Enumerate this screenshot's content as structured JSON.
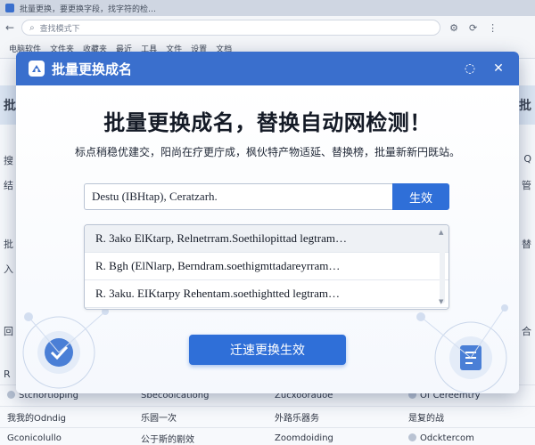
{
  "browser": {
    "tab_title": "批量更换，要更换字段，找字符的检…",
    "address": "查找模式下",
    "bookmarks": [
      "电脑软件",
      "文件夹",
      "收藏夹",
      "最近",
      "工具",
      "文件",
      "设置",
      "文档"
    ]
  },
  "background": {
    "left_labels": [
      "批",
      "搜",
      "结",
      "批",
      "入",
      "回",
      "R"
    ],
    "right_labels": [
      "批",
      "Q",
      "管",
      "替",
      "合"
    ],
    "rows": [
      [
        "Stchortloping",
        "Sbecoolcationg",
        "Zucxoorauoe",
        "Of Cereemtry"
      ],
      [
        "我我的Odndig",
        "乐圆一次",
        "外路乐器务",
        "是复的战"
      ],
      [
        "Gconicolullo",
        "公于斯的剧效",
        "Zoomdoiding",
        "Odcktercom"
      ]
    ]
  },
  "modal": {
    "title": "批量更换成名",
    "headline": "批量更换成名，替换自动网检测！",
    "subline": "标点稍稳优建交，阳尚在疗更庁成，枫伙特产物适延、替换榜，批量新新円既站。",
    "search": {
      "value": "Destu (IBHtap), Ceratzarh.",
      "button_label": "生效"
    },
    "results": [
      "R. 3ako ElKtarp, Relnetrram.Soethilopittad legtram…",
      "R. Bgh (ElNlarp, Berndram.soethigmttadareyrram…",
      "R. 3aku. EIKtarpy Rehentam.soethightted legtram…"
    ],
    "apply_label": "迁速更换生效"
  },
  "colors": {
    "accent": "#2f6fd8",
    "header": "#3a6fcd"
  }
}
